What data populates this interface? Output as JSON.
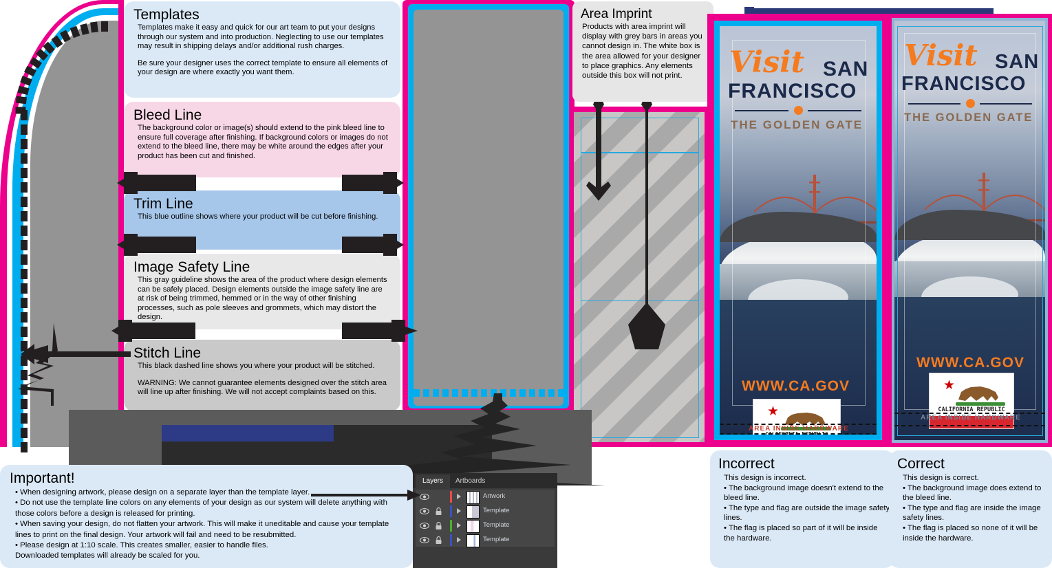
{
  "colors": {
    "bleed_pink": "#ec008c",
    "trim_cyan": "#00aeef",
    "safety_gray": "#949494",
    "stitch_black": "#231f20",
    "heading_blue": "#2e3192",
    "panel_blue": "#dbe9f7",
    "panel_pink": "#f7d7e6",
    "panel_trim_blue": "#a7c7ea",
    "panel_gray": "#e8e8e8",
    "panel_stitch_gray": "#c9c9c9",
    "logo_orange": "#f47b20",
    "logo_navy": "#1b2a4a",
    "flag_red": "#d8262f"
  },
  "panels": {
    "templates": {
      "title": "Templates",
      "body": "Templates make it easy and quick for our art team to put your designs through our system and into production.  Neglecting to use our templates may result in shipping delays and/or additional rush charges.",
      "body2": "Be sure your designer uses the correct template to ensure all elements of your design are where exactly you want them."
    },
    "bleed": {
      "title": "Bleed Line",
      "body": "The background color or image(s) should extend to the pink bleed line to ensure full coverage after finishing. If background colors or images do not extend to the bleed line, there may be white around the  edges after your product has been cut and finished."
    },
    "trim": {
      "title": "Trim Line",
      "body": "This blue outline shows where your product will be cut before finishing."
    },
    "safety": {
      "title": "Image Safety Line",
      "body": "This gray guideline shows the area of the product where design elements can be safely placed. Design elements outside the image safety line are at risk of being trimmed, hemmed or in the way of other finishing processes, such as pole sleeves and grommets, which may distort the design."
    },
    "stitch": {
      "title": "Stitch Line",
      "body": "This black dashed line shows you where your product will be stitched.",
      "body2": "WARNING:  We cannot guarantee elements designed over the stitch area will line up after finishing.  We will not accept complaints based on this."
    },
    "imprint": {
      "title": "Area Imprint",
      "body": "Products with area imprint will display with grey bars in areas you cannot design in.  The white box is the area allowed for your designer to place graphics. Any elements outside this box will not print."
    },
    "important": {
      "title": "Important!",
      "bullets": [
        "• When designing artwork, please design on a separate layer than the template layer.",
        "• Do not use the template line colors on any elements of your design as our system will delete anything with those colors before a design is released for printing.",
        "• When saving your design, do not flatten your artwork.  This will make it uneditable and cause your template lines to print on the final design.  Your artwork will fail and need to be resubmitted.",
        "• Please design at 1:10 scale.  This creates smaller, easier to handle files.",
        "  Downloaded templates will already be scaled for you."
      ]
    },
    "incorrect": {
      "title": "Incorrect",
      "lead": "This design is incorrect.",
      "bullets": [
        "• The background image doesn't extend to the bleed line.",
        "• The type and flag are outside the image safety lines.",
        "• The flag is placed so part of it will be inside the hardware."
      ]
    },
    "correct": {
      "title": "Correct",
      "lead": "This design is correct.",
      "bullets": [
        "• The background image does extend to the bleed line.",
        "• The type and flag are inside the image safety lines.",
        "• The flag is placed so none of it will be inside the hardware."
      ]
    }
  },
  "banner": {
    "visit": "Visit",
    "san": "SAN",
    "francisco": "FRANCISCO",
    "tagline": "THE GOLDEN GATE",
    "url": "WWW.CA.GOV",
    "flag_text": "CALIFORNIA REPUBLIC",
    "hardware_label": "AREA INSIDE HARDWARE"
  },
  "layers_panel": {
    "tabs": [
      {
        "label": "Layers",
        "active": true
      },
      {
        "label": "Artboards",
        "active": false
      }
    ],
    "rows": [
      {
        "name": "Artwork",
        "color": "#ef4a4a",
        "locked": false,
        "visible": true
      },
      {
        "name": "Template",
        "color": "#3b52c4",
        "locked": true,
        "visible": true
      },
      {
        "name": "Template",
        "color": "#4caf2e",
        "locked": true,
        "visible": true
      },
      {
        "name": "Template",
        "color": "#3b52c4",
        "locked": true,
        "visible": true
      }
    ]
  }
}
